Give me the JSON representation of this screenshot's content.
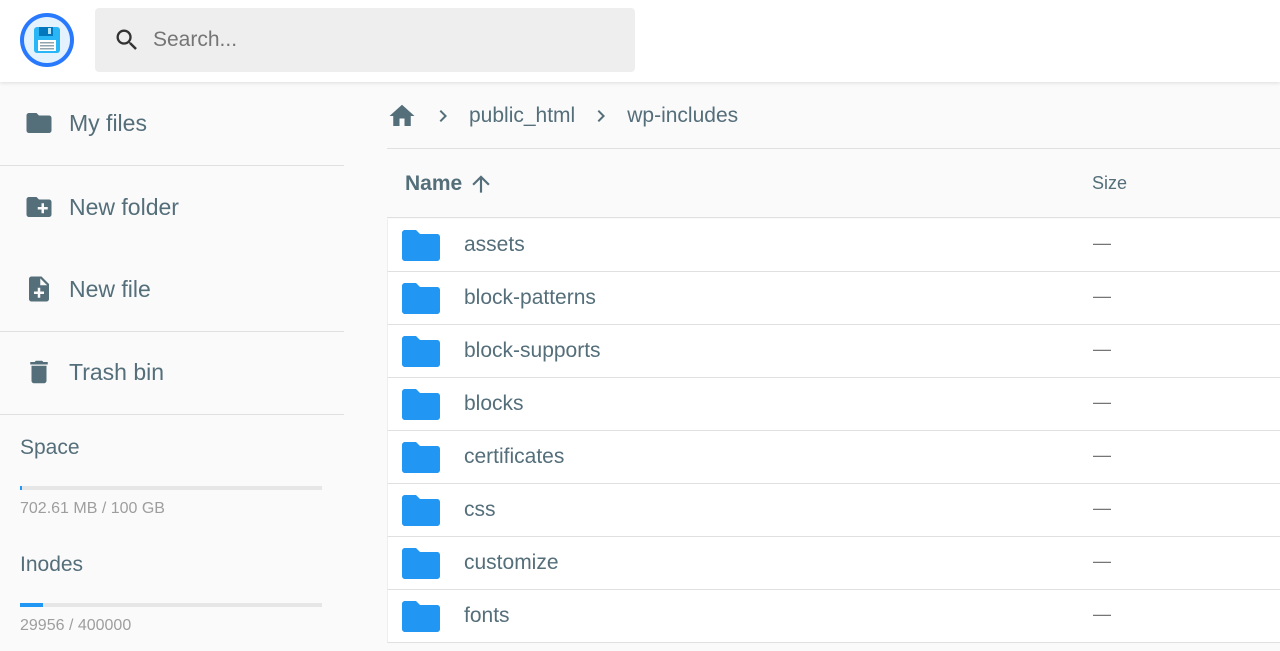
{
  "header": {
    "logo_icon": "floppy-disk-icon",
    "search": {
      "placeholder": "Search...",
      "value": "",
      "icon": "search-icon"
    }
  },
  "sidebar": {
    "items": [
      {
        "label": "My files",
        "icon": "folder-icon"
      },
      {
        "label": "New folder",
        "icon": "folder-plus-icon"
      },
      {
        "label": "New file",
        "icon": "file-plus-icon"
      },
      {
        "label": "Trash bin",
        "icon": "trash-icon"
      }
    ],
    "space": {
      "title": "Space",
      "text": "702.61 MB / 100 GB",
      "fraction": 0.007
    },
    "inodes": {
      "title": "Inodes",
      "text": "29956 / 400000",
      "fraction": 0.075
    }
  },
  "breadcrumb": {
    "home_icon": "home-icon",
    "items": [
      "public_html",
      "wp-includes"
    ]
  },
  "list": {
    "columns": {
      "name": "Name",
      "size": "Size"
    },
    "sort": {
      "column": "Name",
      "direction": "ascending",
      "icon": "arrow-up-icon"
    },
    "rows": [
      {
        "name": "assets",
        "size": "—"
      },
      {
        "name": "block-patterns",
        "size": "—"
      },
      {
        "name": "block-supports",
        "size": "—"
      },
      {
        "name": "blocks",
        "size": "—"
      },
      {
        "name": "certificates",
        "size": "—"
      },
      {
        "name": "css",
        "size": "—"
      },
      {
        "name": "customize",
        "size": "—"
      },
      {
        "name": "fonts",
        "size": "—"
      }
    ]
  },
  "colors": {
    "accent": "#2196f3",
    "folder": "#2196f3",
    "logo_ring": "#2979ff",
    "text": "#546e7a"
  }
}
